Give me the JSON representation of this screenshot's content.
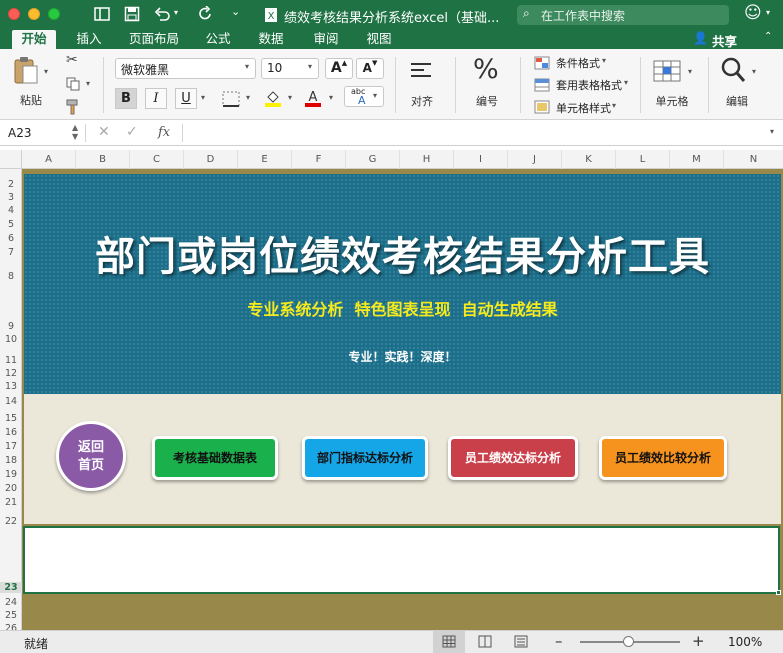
{
  "window": {
    "title": "绩效考核结果分析系统excel（基础...",
    "search_placeholder": "在工作表中搜索"
  },
  "tabs": [
    {
      "label": "开始"
    },
    {
      "label": "插入"
    },
    {
      "label": "页面布局"
    },
    {
      "label": "公式"
    },
    {
      "label": "数据"
    },
    {
      "label": "审阅"
    },
    {
      "label": "视图"
    }
  ],
  "share_label": "共享",
  "ribbon": {
    "paste_label": "粘贴",
    "font_name": "微软雅黑",
    "font_size": "10",
    "bold": "B",
    "italic": "I",
    "underline": "U",
    "align_label": "对齐",
    "number_label": "编号",
    "number_symbol": "%",
    "cond_format": "条件格式",
    "table_format": "套用表格格式",
    "cell_style": "单元格样式",
    "cells_label": "单元格",
    "edit_label": "编辑",
    "font_grow": "A",
    "font_shrink": "A",
    "phonetic": "abc"
  },
  "formula_bar": {
    "cell_ref": "A23",
    "fx": "fx",
    "value": ""
  },
  "columns": [
    "A",
    "B",
    "C",
    "D",
    "E",
    "F",
    "G",
    "H",
    "I",
    "J",
    "K",
    "L",
    "M",
    "N"
  ],
  "rows": [
    {
      "label": "2"
    },
    {
      "label": "3"
    },
    {
      "label": "4"
    },
    {
      "label": "5"
    },
    {
      "label": "6"
    },
    {
      "label": "7"
    },
    {
      "label": "8"
    },
    {
      "label": "9"
    },
    {
      "label": "10"
    },
    {
      "label": "11"
    },
    {
      "label": "12"
    },
    {
      "label": "13"
    },
    {
      "label": "14"
    },
    {
      "label": "15"
    },
    {
      "label": "16"
    },
    {
      "label": "17"
    },
    {
      "label": "18"
    },
    {
      "label": "19"
    },
    {
      "label": "20"
    },
    {
      "label": "21"
    },
    {
      "label": "22"
    },
    {
      "label": "23"
    },
    {
      "label": "24"
    },
    {
      "label": "25"
    },
    {
      "label": "26"
    }
  ],
  "banner": {
    "title": "部门或岗位绩效考核结果分析工具",
    "subtitle": "专业系统分析  特色图表呈现  自动生成结果",
    "tagline": "专业！实践！深度！"
  },
  "nav": {
    "home_line1": "返回",
    "home_line2": "首页",
    "buttons": [
      {
        "label": "考核基础数据表",
        "color": "#1ab04c"
      },
      {
        "label": "部门指标达标分析",
        "color": "#15a6e8"
      },
      {
        "label": "员工绩效达标分析",
        "color": "#c9404a"
      },
      {
        "label": "员工绩效比较分析",
        "color": "#f6921e"
      }
    ]
  },
  "colors": {
    "excel_green": "#1f7244",
    "banner_teal": "#1b6f8b",
    "beige": "#ebe7d9",
    "olive": "#98894a",
    "home_purple": "#8a5aa6",
    "subtitle_yellow": "#f7ea1d"
  },
  "status": {
    "ready": "就绪",
    "zoom": "100%"
  }
}
